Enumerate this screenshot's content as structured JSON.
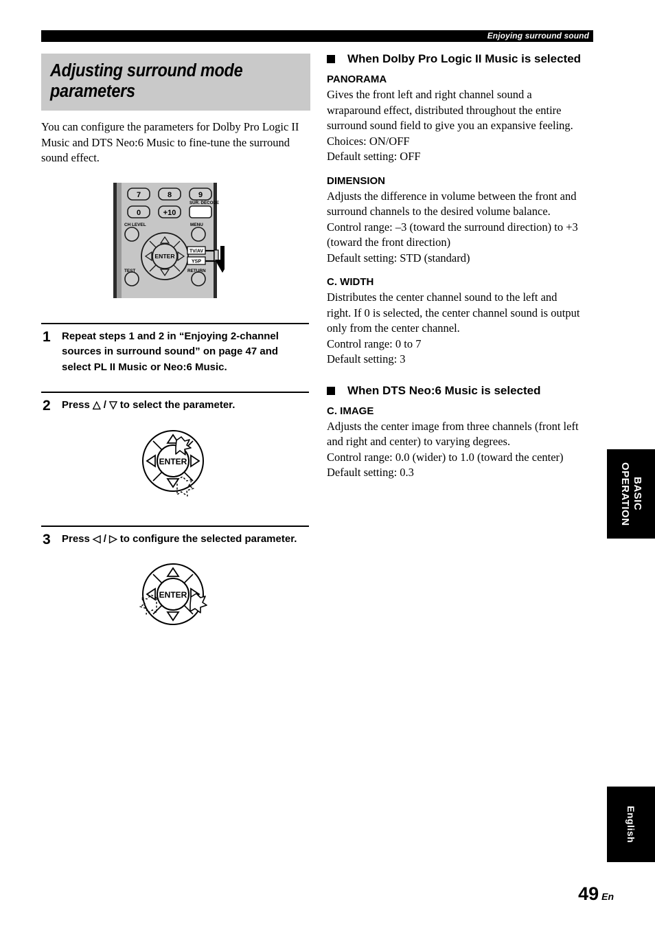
{
  "running_head": "Enjoying surround sound",
  "left_column": {
    "title": "Adjusting surround mode parameters",
    "intro": "You can configure the parameters for Dolby Pro Logic II Music and DTS Neo:6 Music to fine-tune the surround sound effect.",
    "remote_figure": {
      "buttons": [
        "7",
        "8",
        "9",
        "0",
        "+10"
      ],
      "sur_decode_label": "SUR. DECODE",
      "ch_level_label": "CH LEVEL",
      "menu_label": "MENU",
      "test_label": "TEST",
      "return_label": "RETURN",
      "enter_label": "ENTER",
      "switch_top_label": "TV/AV",
      "switch_bottom_label": "YSP",
      "pointer_icon": "down-arrow-icon"
    },
    "steps": [
      {
        "number": "1",
        "text": "Repeat steps 1 and 2 in “Enjoying 2-channel sources in surround sound” on page 47 and select PL II Music or Neo:6 Music."
      },
      {
        "number": "2",
        "text_before": "Press ",
        "keys": "△ / ▽",
        "text_after": " to select the parameter.",
        "figure_enter_label": "ENTER"
      },
      {
        "number": "3",
        "text_before": "Press ",
        "keys": "◁ / ▷",
        "text_after": " to configure the selected parameter.",
        "figure_enter_label": "ENTER"
      }
    ]
  },
  "right_column": {
    "sections": [
      {
        "heading": "When Dolby Pro Logic II Music is selected",
        "params": [
          {
            "name": "PANORAMA",
            "description": "Gives the front left and right channel sound a wraparound effect, distributed throughout the entire surround sound field to give you an expansive feeling.",
            "choices": "Choices: ON/OFF",
            "default": "Default setting: OFF"
          },
          {
            "name": "DIMENSION",
            "description": "Adjusts the difference in volume between the front and surround channels to the desired volume balance.",
            "choices": "Control range: –3 (toward the surround direction) to +3 (toward the front direction)",
            "default": "Default setting: STD (standard)"
          },
          {
            "name": "C. WIDTH",
            "description": "Distributes the center channel sound to the left and right. If 0 is selected, the center channel sound is output only from the center channel.",
            "choices": "Control range: 0 to 7",
            "default": "Default setting: 3"
          }
        ]
      },
      {
        "heading": "When DTS Neo:6 Music is selected",
        "params": [
          {
            "name": "C. IMAGE",
            "description": "Adjusts the center image from three channels (front left and right and center) to varying degrees.",
            "choices": "Control range: 0.0 (wider) to 1.0 (toward the center)",
            "default": "Default setting: 0.3"
          }
        ]
      }
    ]
  },
  "side_tabs": {
    "basic_operation": "BASIC OPERATION",
    "english": "English"
  },
  "footer": {
    "page_number": "49",
    "page_suffix": "En"
  },
  "colors": {
    "title_band": "#c9c9c9",
    "tab_bg": "#000000",
    "remote_body": "#c0c0c0"
  }
}
